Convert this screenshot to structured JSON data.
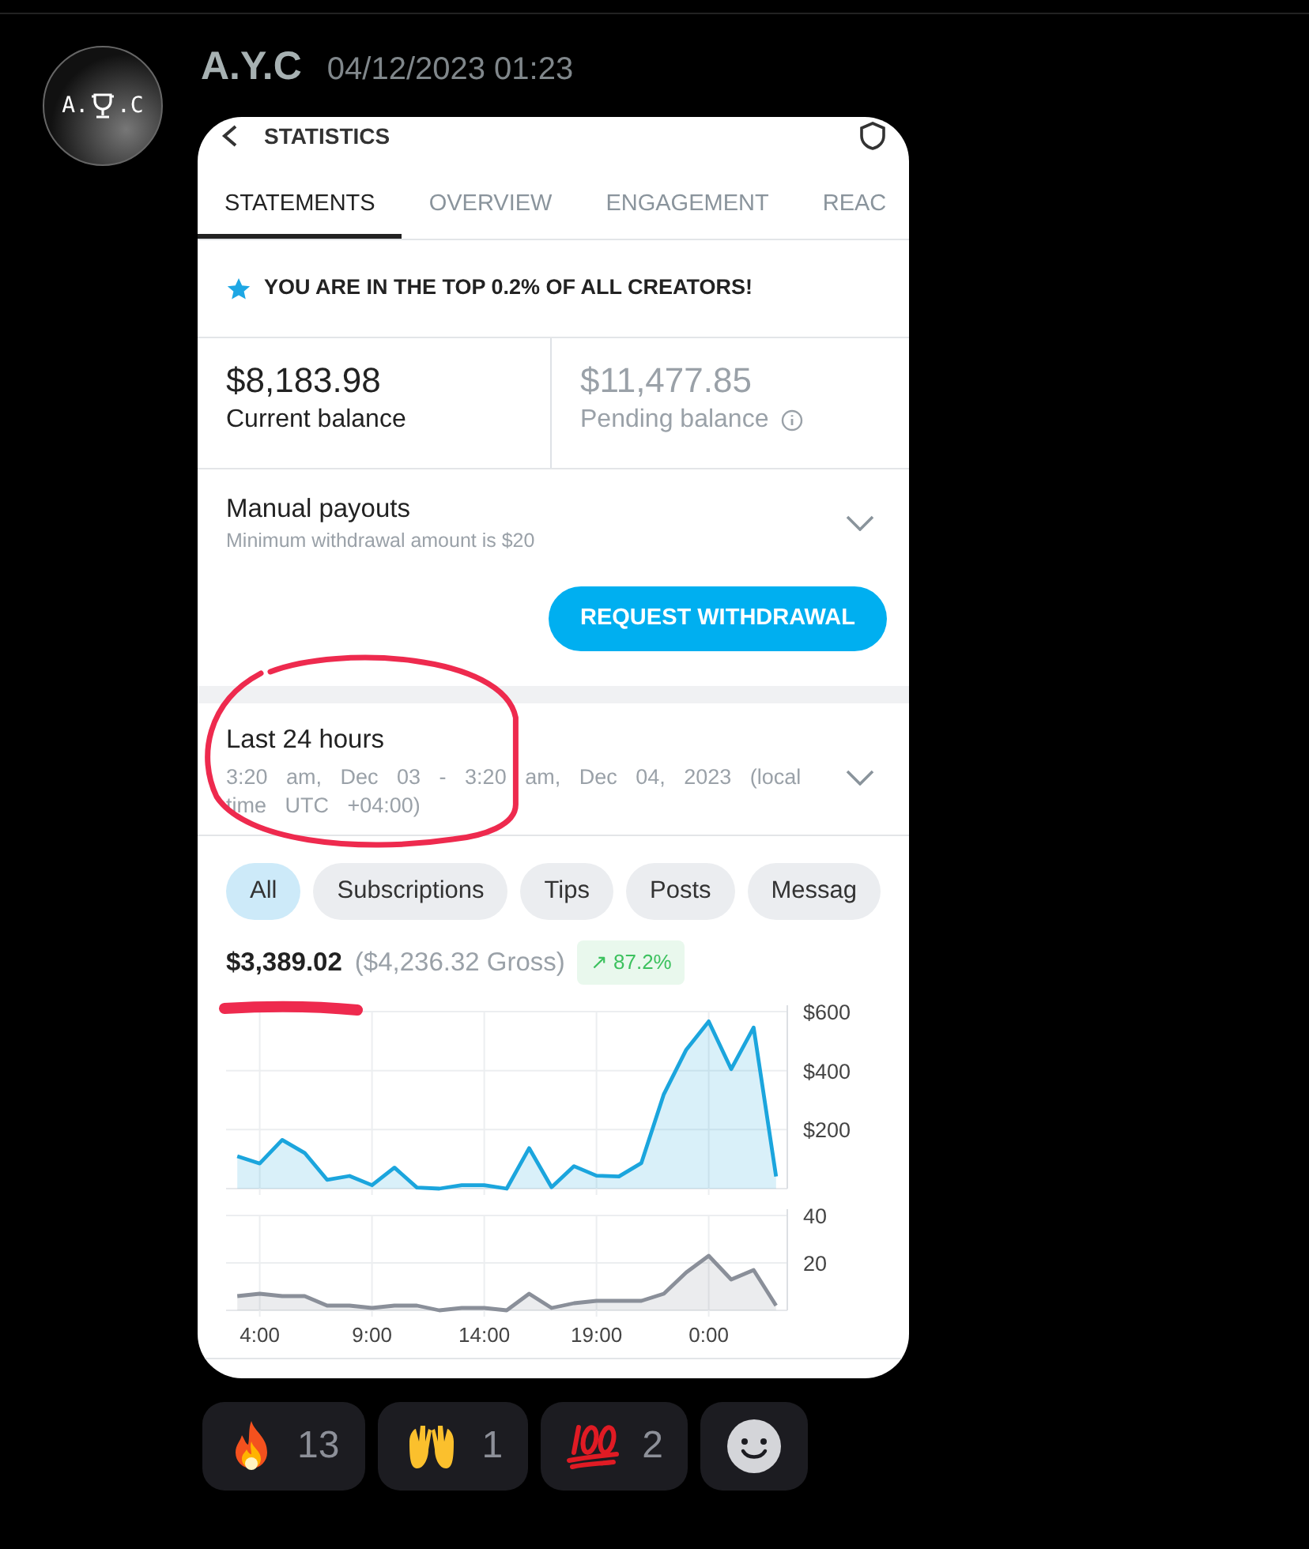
{
  "message": {
    "author": "A.Y.C",
    "timestamp": "04/12/2023 01:23",
    "avatar": {
      "text_left": "A.",
      "text_right": ".C"
    }
  },
  "screenshot": {
    "title": "STATISTICS",
    "tabs": [
      {
        "label": "STATEMENTS",
        "selected": true
      },
      {
        "label": "OVERVIEW",
        "selected": false
      },
      {
        "label": "ENGAGEMENT",
        "selected": false
      },
      {
        "label": "REAC",
        "selected": false
      }
    ],
    "banner": "YOU ARE IN THE TOP 0.2% OF ALL CREATORS!",
    "balances": [
      {
        "kind": "current",
        "amount": "$8,183.98",
        "label": "Current balance"
      },
      {
        "kind": "pending",
        "amount": "$11,477.85",
        "label": "Pending balance"
      }
    ],
    "payouts": {
      "title": "Manual payouts",
      "subtitle": "Minimum withdrawal amount is $20",
      "button": "REQUEST WITHDRAWAL"
    },
    "period": {
      "title": "Last 24 hours",
      "subtitle": "3:20 am, Dec 03 - 3:20 am, Dec 04, 2023 (local time UTC +04:00)"
    },
    "filters": [
      {
        "label": "All",
        "selected": true
      },
      {
        "label": "Subscriptions",
        "selected": false
      },
      {
        "label": "Tips",
        "selected": false
      },
      {
        "label": "Posts",
        "selected": false
      },
      {
        "label": "Messag",
        "selected": false
      }
    ],
    "summary": {
      "net": "$3,389.02",
      "gross": "($4,236.32 Gross)",
      "change": "↗ 87.2%"
    },
    "earnings_chart": {
      "chart_data": {
        "type": "area",
        "series": [
          {
            "color": "#1ba5dd",
            "values": [
              110,
              85,
              165,
              121,
              30,
              43,
              12,
              71,
              4,
              0,
              12,
              12,
              0,
              137,
              5,
              76,
              44,
              41,
              87,
              320,
              471,
              567,
              405,
              546,
              41
            ]
          }
        ],
        "grid": true,
        "ylim": [
          0,
          600
        ],
        "yticks": [
          {
            "value": 200,
            "label": "$200"
          },
          {
            "value": 400,
            "label": "$400"
          },
          {
            "value": 600,
            "label": "$600"
          }
        ]
      }
    },
    "count_chart": {
      "chart_data": {
        "type": "area",
        "categories": [
          null,
          "4:00",
          null,
          null,
          null,
          null,
          "9:00",
          null,
          null,
          null,
          null,
          "14:00",
          null,
          null,
          null,
          null,
          "19:00",
          null,
          null,
          null,
          null,
          "0:00",
          null,
          null,
          null
        ],
        "series": [
          {
            "color": "#8a8f99",
            "values": [
              6,
              7,
              6,
              6,
              2,
              2,
              1,
              2,
              2,
              0,
              1,
              1,
              0,
              7,
              1,
              3,
              4,
              4,
              4,
              7,
              16,
              23,
              13,
              17,
              2
            ]
          }
        ],
        "grid": true,
        "ylim": [
          0,
          40
        ],
        "yticks": [
          20,
          40
        ]
      }
    },
    "markup": {
      "period_circled": true,
      "net_underlined": true
    }
  },
  "reactions": [
    {
      "kind": "fire",
      "count": "13"
    },
    {
      "kind": "hands",
      "count": "1"
    },
    {
      "kind": "hundred",
      "count": "2"
    }
  ]
}
